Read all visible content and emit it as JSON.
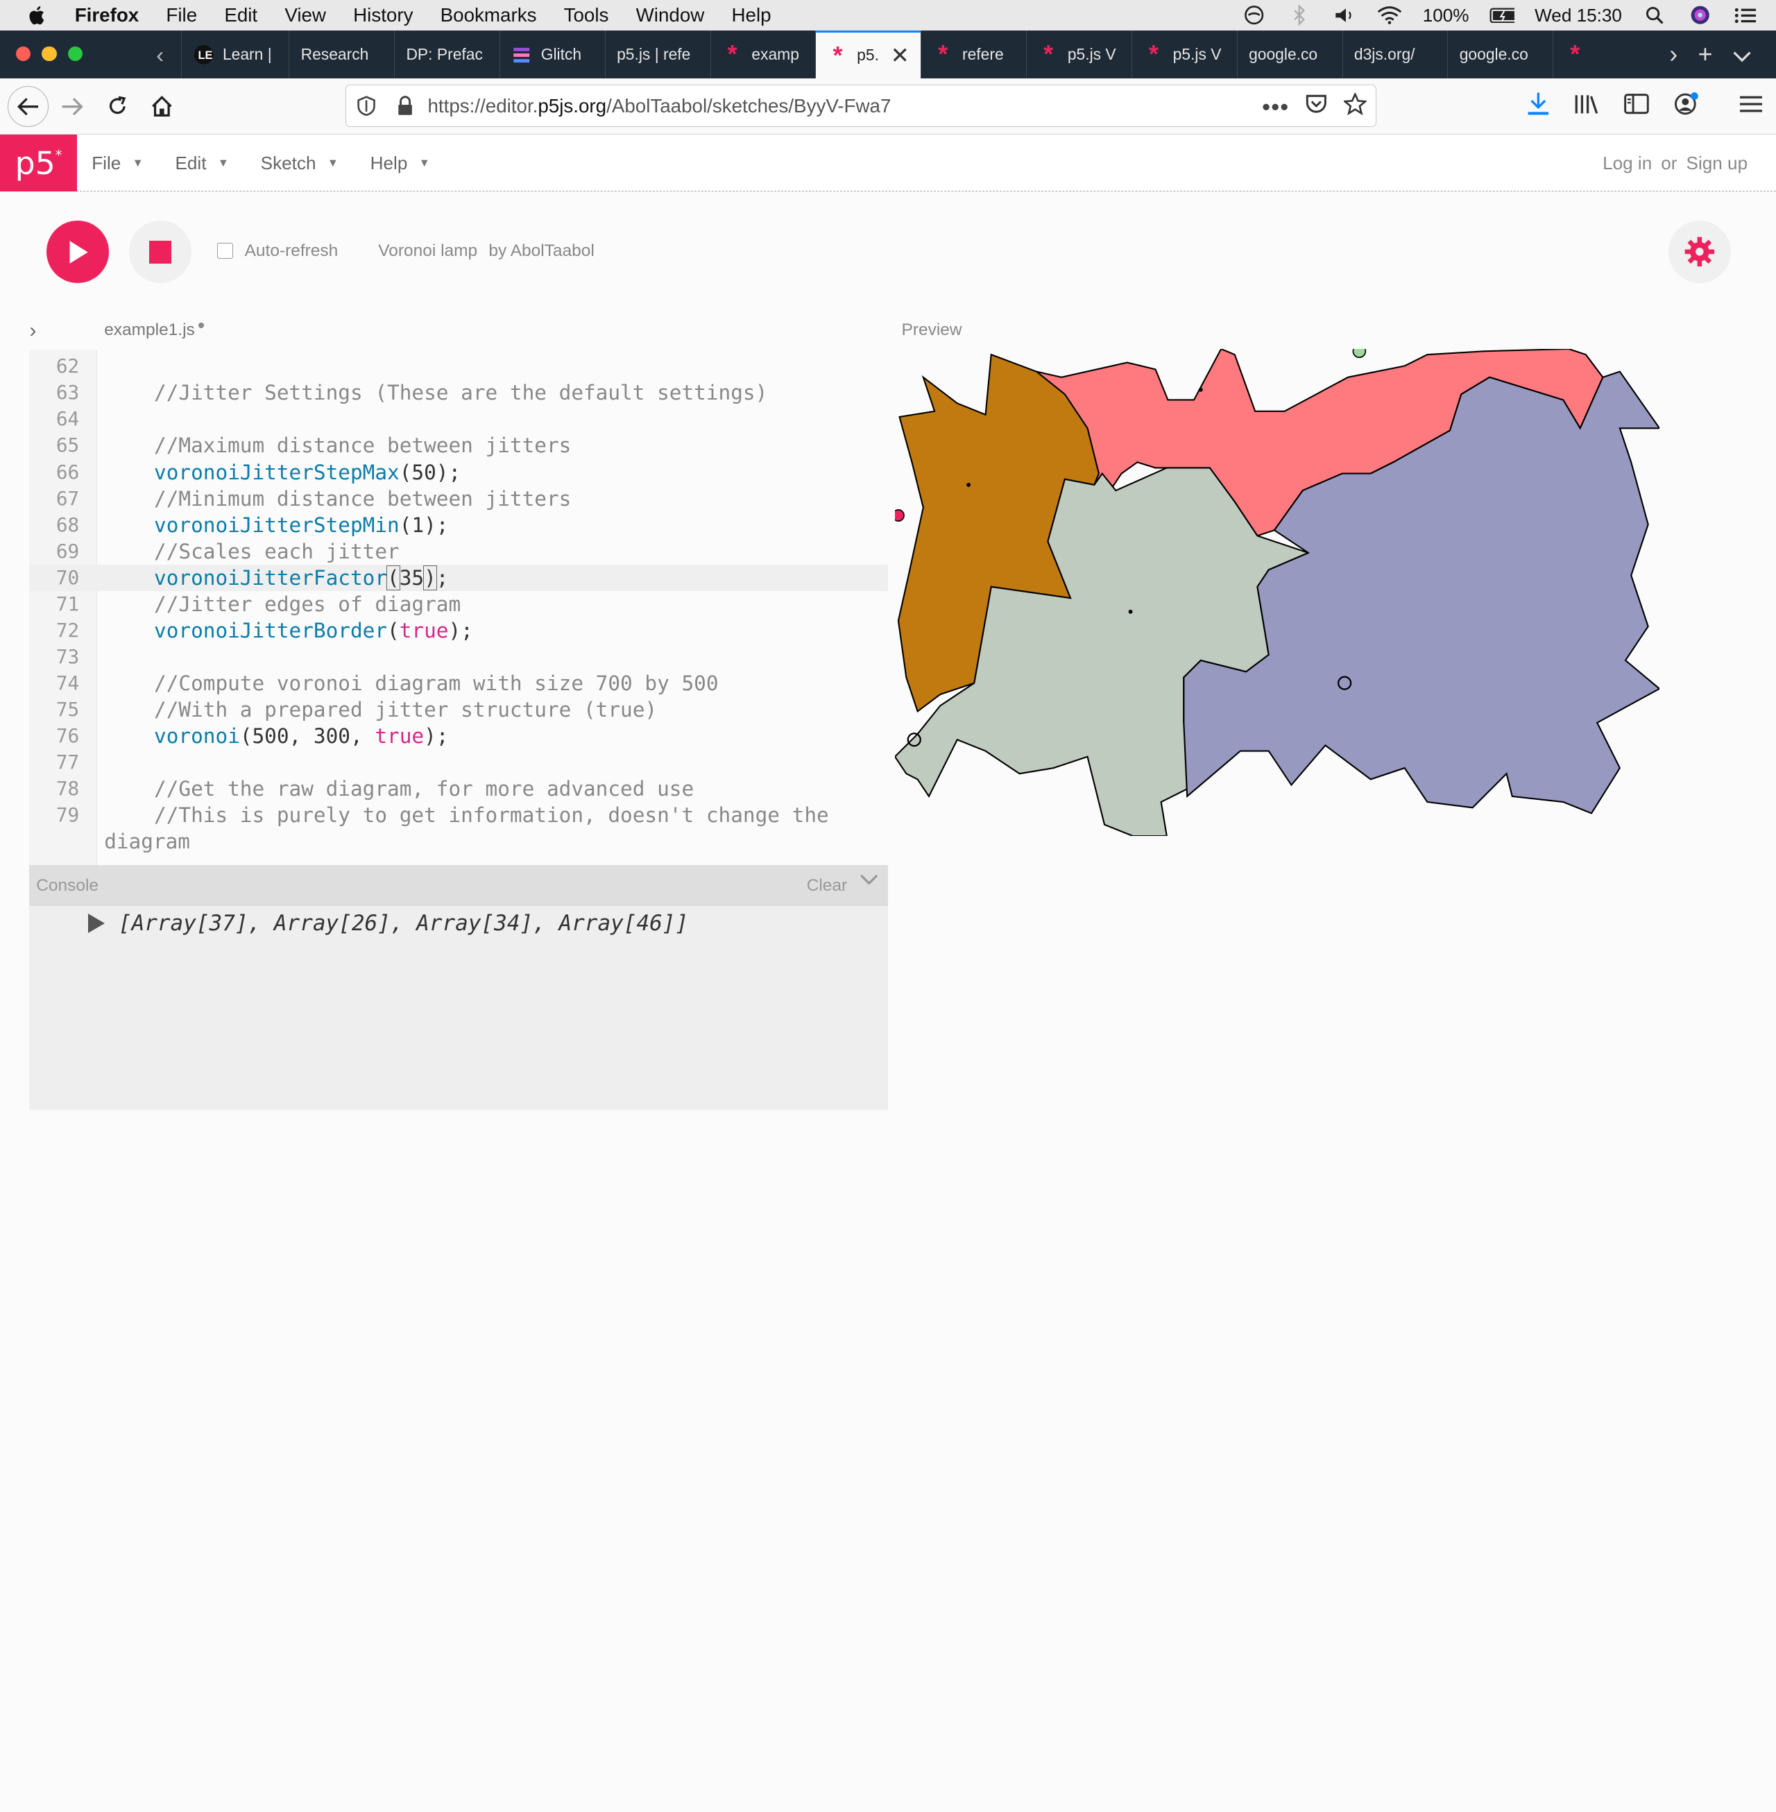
{
  "menubar": {
    "app": "Firefox",
    "items": [
      "File",
      "Edit",
      "View",
      "History",
      "Bookmarks",
      "Tools",
      "Window",
      "Help"
    ],
    "battery": "100%",
    "clock": "Wed 15:30"
  },
  "tabs": [
    {
      "label": "Learn |",
      "icon": "learn-icon"
    },
    {
      "label": "Research",
      "icon": ""
    },
    {
      "label": "DP: Prefac",
      "icon": ""
    },
    {
      "label": "Glitch",
      "icon": "glitch-icon"
    },
    {
      "label": "p5.js | refe",
      "icon": ""
    },
    {
      "label": "examp",
      "icon": "p5-asterisk-icon"
    },
    {
      "label": "p5.",
      "icon": "p5-asterisk-icon",
      "active": true
    },
    {
      "label": "refere",
      "icon": "p5-asterisk-icon"
    },
    {
      "label": "p5.js V",
      "icon": "p5-asterisk-icon"
    },
    {
      "label": "p5.js V",
      "icon": "p5-asterisk-icon"
    },
    {
      "label": "google.co",
      "icon": ""
    },
    {
      "label": "d3js.org/",
      "icon": ""
    },
    {
      "label": "google.co",
      "icon": ""
    },
    {
      "label": "",
      "icon": "p5-asterisk-icon"
    }
  ],
  "address": {
    "prefix": "https://editor.",
    "domain": "p5js.org",
    "path": "/AbolTaabol/sketches/ByyV-Fwa7"
  },
  "p5": {
    "logo": "p5",
    "menu": [
      "File",
      "Edit",
      "Sketch",
      "Help"
    ],
    "login": "Log in",
    "or": "or",
    "signup": "Sign up",
    "autorefresh": "Auto-refresh",
    "sketch_name": "Voronoi lamp",
    "by": "by AbolTaabol",
    "filename": "example1.js",
    "preview_label": "Preview",
    "console_title": "Console",
    "console_clear": "Clear",
    "console_output": "[Array[37], Array[26], Array[34], Array[46]]"
  },
  "code": [
    {
      "n": "62",
      "parts": []
    },
    {
      "n": "63",
      "parts": [
        [
          "c-cm",
          "//Jitter Settings (These are the default settings)"
        ]
      ]
    },
    {
      "n": "64",
      "parts": []
    },
    {
      "n": "65",
      "parts": [
        [
          "c-cm",
          "//Maximum distance between jitters"
        ]
      ]
    },
    {
      "n": "66",
      "parts": [
        [
          "c-fn",
          "voronoiJitterStepMax"
        ],
        [
          "c-pl",
          "(50);"
        ]
      ]
    },
    {
      "n": "67",
      "parts": [
        [
          "c-cm",
          "//Minimum distance between jitters"
        ]
      ]
    },
    {
      "n": "68",
      "parts": [
        [
          "c-fn",
          "voronoiJitterStepMin"
        ],
        [
          "c-pl",
          "(1);"
        ]
      ]
    },
    {
      "n": "69",
      "parts": [
        [
          "c-cm",
          "//Scales each jitter"
        ]
      ]
    },
    {
      "n": "70",
      "hl": true,
      "parts": [
        [
          "c-fn",
          "voronoiJitterFactor"
        ],
        [
          "c-pl cursor-box",
          "("
        ],
        [
          "c-pl",
          "35"
        ],
        [
          "c-pl cursor-box",
          ")"
        ],
        [
          "c-pl",
          ";"
        ]
      ]
    },
    {
      "n": "71",
      "parts": [
        [
          "c-cm",
          "//Jitter edges of diagram"
        ]
      ]
    },
    {
      "n": "72",
      "parts": [
        [
          "c-fn",
          "voronoiJitterBorder"
        ],
        [
          "c-pl",
          "("
        ],
        [
          "c-kw",
          "true"
        ],
        [
          "c-pl",
          ");"
        ]
      ]
    },
    {
      "n": "73",
      "parts": []
    },
    {
      "n": "74",
      "parts": [
        [
          "c-cm",
          "//Compute voronoi diagram with size 700 by 500"
        ]
      ]
    },
    {
      "n": "75",
      "parts": [
        [
          "c-cm",
          "//With a prepared jitter structure (true)"
        ]
      ]
    },
    {
      "n": "76",
      "parts": [
        [
          "c-fn",
          "voronoi"
        ],
        [
          "c-pl",
          "(500, 300, "
        ],
        [
          "c-kw",
          "true"
        ],
        [
          "c-pl",
          ");"
        ]
      ]
    },
    {
      "n": "77",
      "parts": []
    },
    {
      "n": "78",
      "parts": [
        [
          "c-cm",
          "//Get the raw diagram, for more advanced use"
        ]
      ]
    },
    {
      "n": "79",
      "parts": [
        [
          "c-cm",
          "//This is purely to get information, doesn't change the"
        ]
      ]
    },
    {
      "n": "",
      "cont": "diagram"
    }
  ],
  "colors": {
    "p5_pink": "#ed225d",
    "cell_brown": "#c07a10",
    "cell_salmon": "#ff7a7f",
    "cell_sage": "#c0cbbf",
    "cell_lavender": "#9899c1"
  }
}
